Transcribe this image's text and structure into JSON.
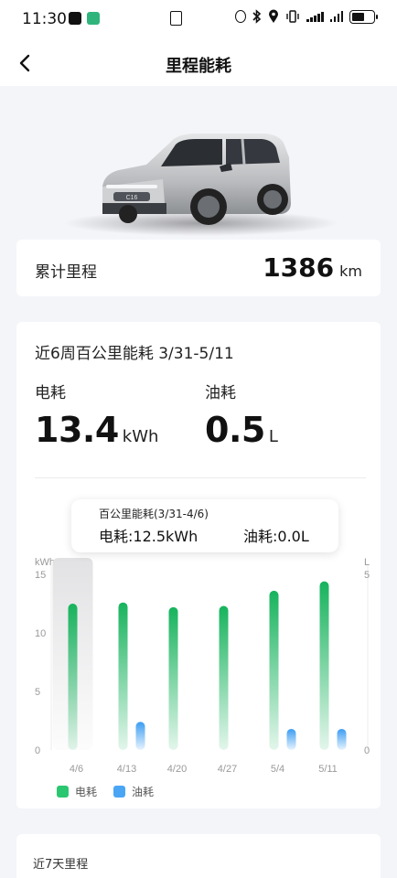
{
  "status_bar": {
    "time": "11:30",
    "icons": [
      "app-icon",
      "app-icon",
      "nfc-icon",
      "alarm-icon",
      "bluetooth-icon",
      "location-icon",
      "vibrate-icon",
      "signal-icon",
      "signal-icon",
      "battery-icon"
    ]
  },
  "header": {
    "title": "里程能耗",
    "back_icon": "back-arrow-icon"
  },
  "odometer": {
    "label": "累计里程",
    "value": "1386",
    "unit": "km"
  },
  "energy": {
    "title": "近6周百公里能耗 3/31-5/11",
    "electric_label": "电耗",
    "electric_value": "13.4",
    "electric_unit": "kWh",
    "fuel_label": "油耗",
    "fuel_value": "0.5",
    "fuel_unit": "L",
    "tooltip": {
      "title": "百公里能耗(3/31-4/6)",
      "electric": "电耗:12.5kWh",
      "fuel": "油耗:0.0L"
    },
    "colors": {
      "electric": "#2bc770",
      "fuel": "#4aa6f5"
    }
  },
  "chart_data": {
    "type": "bar",
    "categories": [
      "4/6",
      "4/13",
      "4/20",
      "4/27",
      "5/4",
      "5/11"
    ],
    "series": [
      {
        "name": "电耗",
        "axis": "left",
        "values": [
          12.5,
          12.6,
          12.2,
          12.3,
          13.6,
          14.4
        ]
      },
      {
        "name": "油耗",
        "axis": "right",
        "values": [
          0.0,
          0.8,
          0.0,
          0.0,
          0.6,
          0.6
        ]
      }
    ],
    "y_left": {
      "label": "kWh",
      "ticks": [
        "15",
        "10",
        "5",
        "0"
      ],
      "lim": [
        0,
        15
      ]
    },
    "y_right": {
      "label": "L",
      "ticks": [
        "5",
        "0"
      ],
      "lim": [
        0,
        5
      ]
    },
    "selected_category": "4/6",
    "legend": [
      "电耗",
      "油耗"
    ],
    "legend_position": "bottom-left"
  },
  "recent": {
    "title": "近7天里程"
  }
}
